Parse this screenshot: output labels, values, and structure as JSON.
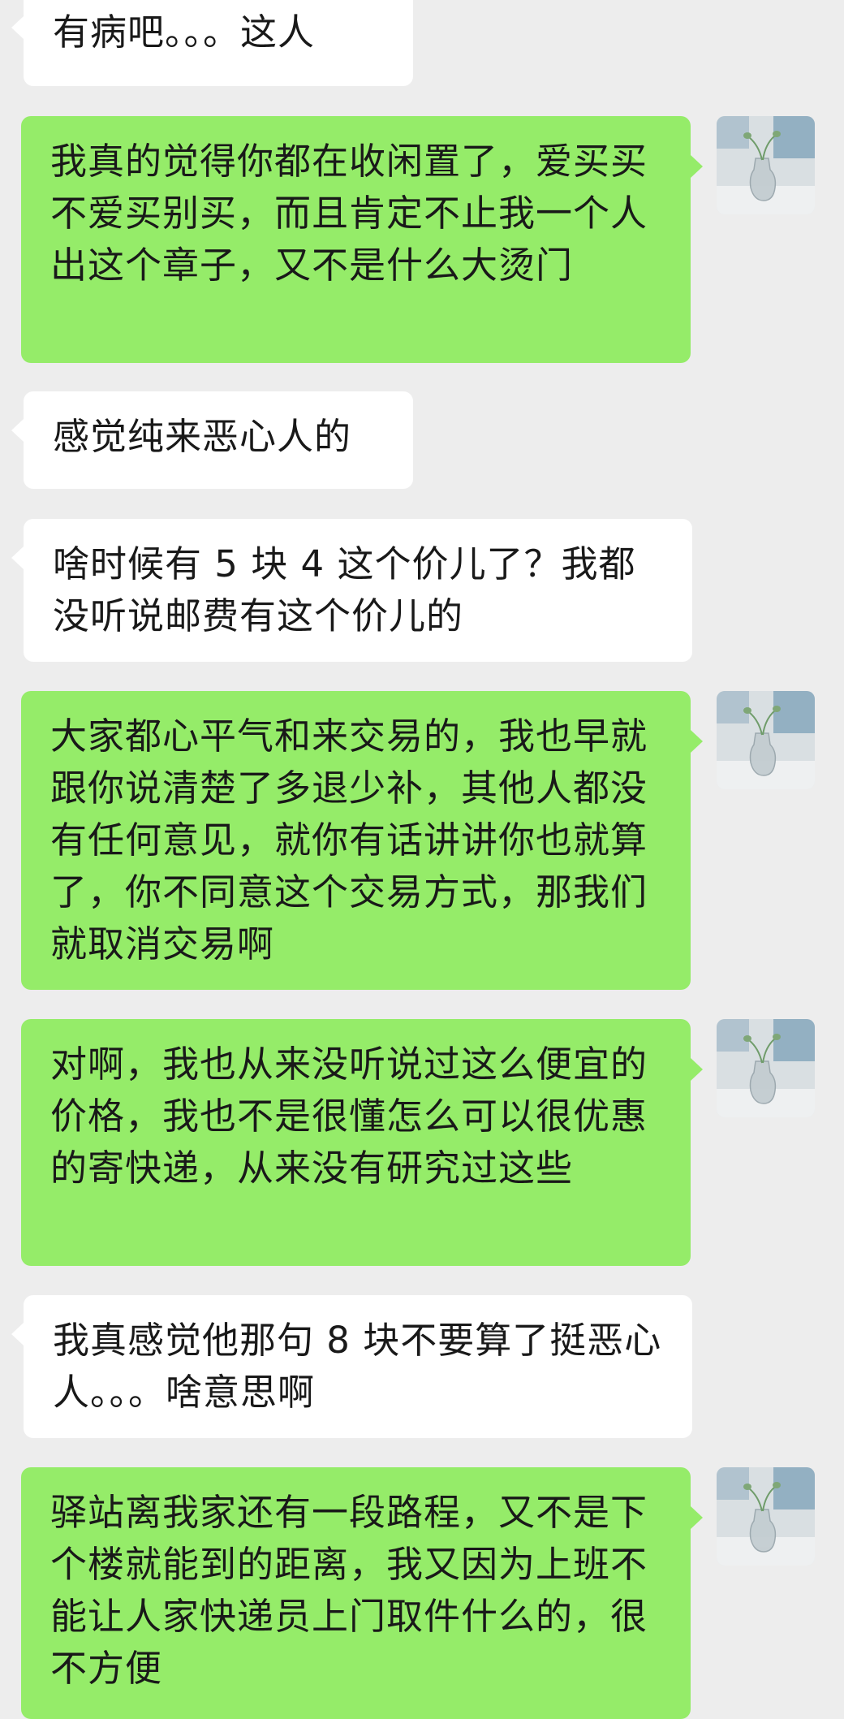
{
  "chat": {
    "messages": [
      {
        "side": "in",
        "text": "有病吧。。。这人"
      },
      {
        "side": "out",
        "text": "我真的觉得你都在收闲置了，爱买买不爱买别买，而且肯定不止我一个人出这个章子，又不是什么大烫门"
      },
      {
        "side": "in",
        "text": "感觉纯来恶心人的"
      },
      {
        "side": "in",
        "text": "啥时候有 5 块 4 这个价儿了？我都没听说邮费有这个价儿的"
      },
      {
        "side": "out",
        "text": "大家都心平气和来交易的，我也早就跟你说清楚了多退少补，其他人都没有任何意见，就你有话讲讲你也就算了，你不同意这个交易方式，那我们就取消交易啊"
      },
      {
        "side": "out",
        "text": "对啊，我也从来没听说过这么便宜的价格，我也不是很懂怎么可以很优惠的寄快递，从来没有研究过这些"
      },
      {
        "side": "in",
        "text": "我真感觉他那句 8 块不要算了挺恶心人。。。啥意思啊"
      },
      {
        "side": "out",
        "text": "驿站离我家还有一段路程，又不是下个楼就能到的距离，我又因为上班不能让人家快递员上门取件什么的，很不方便"
      }
    ]
  },
  "colors": {
    "background": "#ededed",
    "incoming_bubble": "#ffffff",
    "outgoing_bubble": "#95ec69",
    "text": "#191919"
  },
  "icons": {
    "avatar": "vase-photo-avatar"
  }
}
